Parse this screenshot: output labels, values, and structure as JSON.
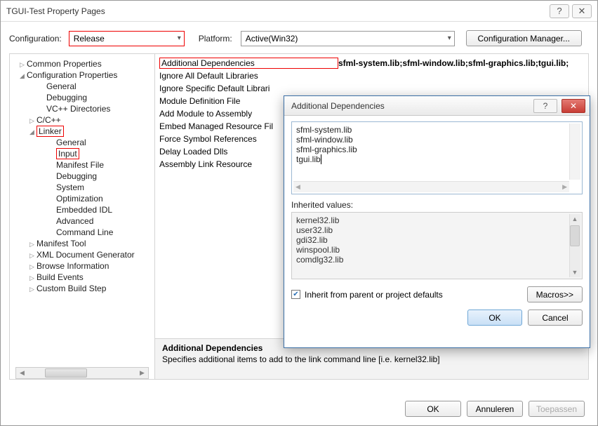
{
  "window": {
    "title": "TGUI-Test Property Pages"
  },
  "config": {
    "configuration_label": "Configuration:",
    "configuration_value": "Release",
    "platform_label": "Platform:",
    "platform_value": "Active(Win32)",
    "config_manager_btn": "Configuration Manager..."
  },
  "tree": {
    "items": [
      {
        "label": "Common Properties",
        "exp": "▷",
        "indent": 0
      },
      {
        "label": "Configuration Properties",
        "exp": "◢",
        "indent": 0
      },
      {
        "label": "General",
        "exp": "",
        "indent": 2
      },
      {
        "label": "Debugging",
        "exp": "",
        "indent": 2
      },
      {
        "label": "VC++ Directories",
        "exp": "",
        "indent": 2
      },
      {
        "label": "C/C++",
        "exp": "▷",
        "indent": 1
      },
      {
        "label": "Linker",
        "exp": "◢",
        "indent": 1,
        "hl": true
      },
      {
        "label": "General",
        "exp": "",
        "indent": 3
      },
      {
        "label": "Input",
        "exp": "",
        "indent": 3,
        "hl": true
      },
      {
        "label": "Manifest File",
        "exp": "",
        "indent": 3
      },
      {
        "label": "Debugging",
        "exp": "",
        "indent": 3
      },
      {
        "label": "System",
        "exp": "",
        "indent": 3
      },
      {
        "label": "Optimization",
        "exp": "",
        "indent": 3
      },
      {
        "label": "Embedded IDL",
        "exp": "",
        "indent": 3
      },
      {
        "label": "Advanced",
        "exp": "",
        "indent": 3
      },
      {
        "label": "Command Line",
        "exp": "",
        "indent": 3
      },
      {
        "label": "Manifest Tool",
        "exp": "▷",
        "indent": 1
      },
      {
        "label": "XML Document Generator",
        "exp": "▷",
        "indent": 1
      },
      {
        "label": "Browse Information",
        "exp": "▷",
        "indent": 1
      },
      {
        "label": "Build Events",
        "exp": "▷",
        "indent": 1
      },
      {
        "label": "Custom Build Step",
        "exp": "▷",
        "indent": 1
      }
    ]
  },
  "props": {
    "rows": [
      {
        "name": "Additional Dependencies",
        "hl": true,
        "value": "sfml-system.lib;sfml-window.lib;sfml-graphics.lib;tgui.lib;"
      },
      {
        "name": "Ignore All Default Libraries"
      },
      {
        "name": "Ignore Specific Default Librari"
      },
      {
        "name": "Module Definition File"
      },
      {
        "name": "Add Module to Assembly"
      },
      {
        "name": "Embed Managed Resource Fil"
      },
      {
        "name": "Force Symbol References"
      },
      {
        "name": "Delay Loaded Dlls"
      },
      {
        "name": "Assembly Link Resource"
      }
    ],
    "desc_title": "Additional Dependencies",
    "desc_text": "Specifies additional items to add to the link command line [i.e. kernel32.lib]"
  },
  "footer": {
    "ok": "OK",
    "cancel": "Annuleren",
    "apply": "Toepassen"
  },
  "dialog": {
    "title": "Additional Dependencies",
    "textarea_lines": [
      "sfml-system.lib",
      "sfml-window.lib",
      "sfml-graphics.lib",
      "tgui.lib"
    ],
    "inherited_label": "Inherited values:",
    "inherited": [
      "kernel32.lib",
      "user32.lib",
      "gdi32.lib",
      "winspool.lib",
      "comdlg32.lib"
    ],
    "inherit_checkbox": "Inherit from parent or project defaults",
    "inherit_checked": true,
    "macros_btn": "Macros>>",
    "ok": "OK",
    "cancel": "Cancel"
  }
}
